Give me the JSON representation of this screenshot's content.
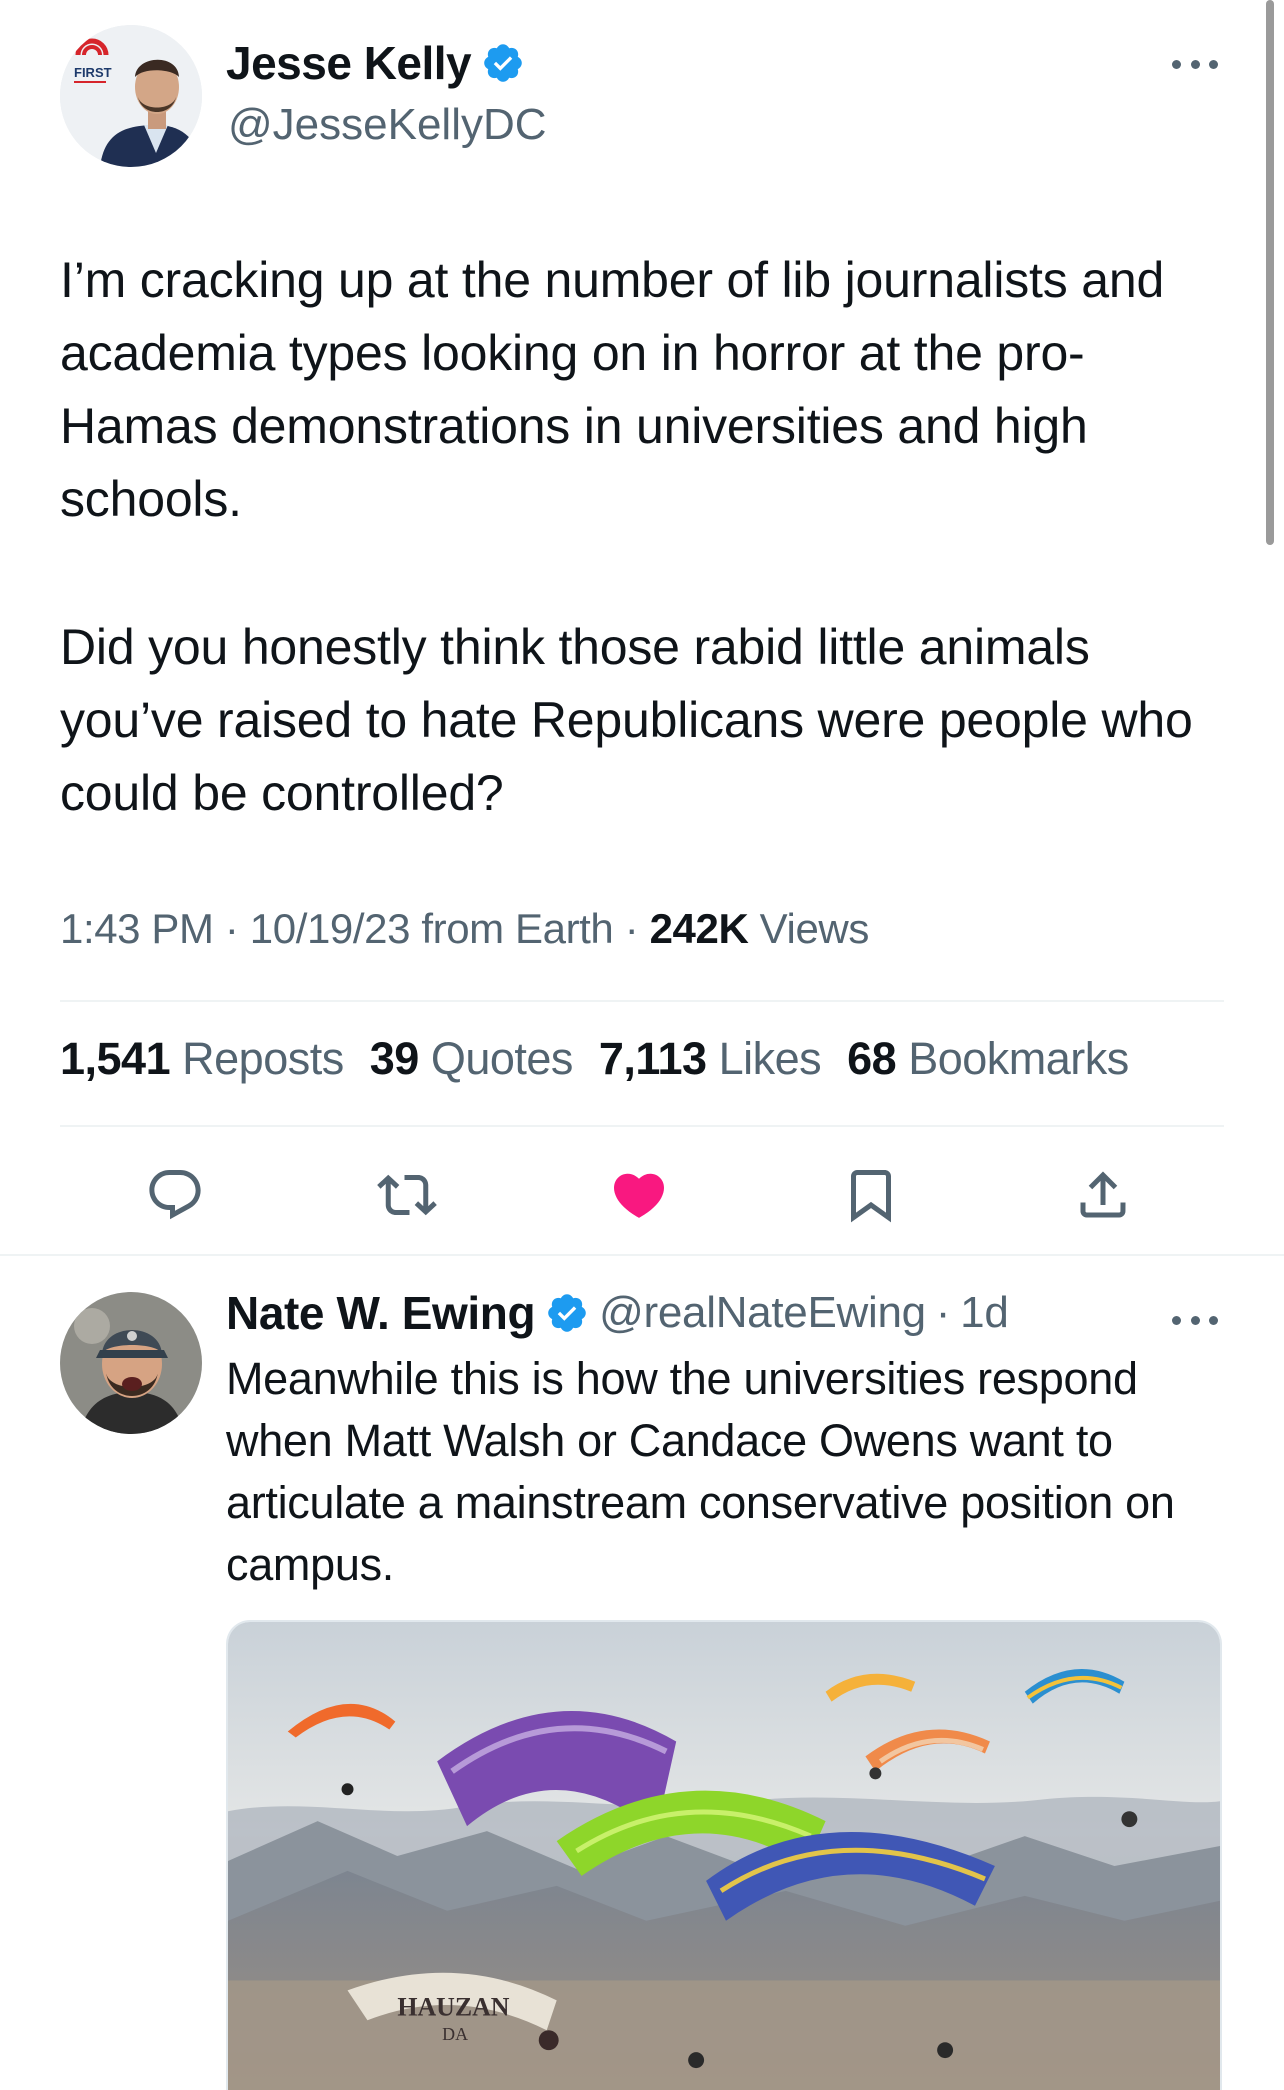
{
  "main_tweet": {
    "author": {
      "name": "Jesse Kelly",
      "handle": "@JesseKellyDC",
      "avatar_badge": "THE FIRST"
    },
    "paragraphs": [
      "I’m cracking up at the number of lib journalists and academia types looking on in horror at the pro-Hamas demonstrations in universities and high schools.",
      "Did you honestly think those rabid little animals you’ve raised to hate Republicans were people who could be controlled?"
    ],
    "time": "1:43 PM",
    "separator": "·",
    "date_source": "10/19/23 from Earth",
    "views_count": "242K",
    "views_label": "Views",
    "stats": {
      "reposts_count": "1,541",
      "reposts_label": "Reposts",
      "quotes_count": "39",
      "quotes_label": "Quotes",
      "likes_count": "7,113",
      "likes_label": "Likes",
      "bookmarks_count": "68",
      "bookmarks_label": "Bookmarks"
    },
    "actions": [
      "reply-icon",
      "repost-icon",
      "like-icon-filled",
      "bookmark-icon",
      "share-icon"
    ],
    "liked": true
  },
  "reply_tweet": {
    "author": {
      "name": "Nate W. Ewing",
      "handle": "@realNateEwing",
      "separator": "·",
      "age": "1d"
    },
    "text": "Meanwhile this is how the universities respond when Matt Walsh or Candace Owens want to articulate a mainstream conservative position on campus.",
    "media": {
      "description_icon": "paragliders-image",
      "visible_lettering": [
        "HAUZAN",
        "DA"
      ]
    }
  },
  "colors": {
    "text_primary": "#0f1419",
    "text_secondary": "#536471",
    "verified_blue": "#1d9bf0",
    "like_pink": "#f91880",
    "divider": "#eff3f4"
  }
}
